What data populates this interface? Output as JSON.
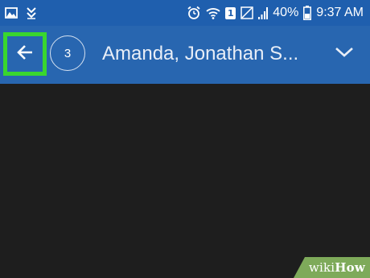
{
  "status_bar": {
    "battery_percent": "40%",
    "clock": "9:37 AM",
    "sim_label": "1",
    "icons": [
      "image-icon",
      "download-check-icon",
      "alarm-icon",
      "wifi-icon",
      "sim-icon",
      "no-signal-icon",
      "signal-icon",
      "battery-icon"
    ]
  },
  "app_bar": {
    "participant_count": "3",
    "conversation_title": "Amanda, Jonathan S...",
    "back_icon": "arrow-left-icon",
    "expand_icon": "chevron-down-icon",
    "highlight_color": "#39d62f",
    "bar_color": "#2866b0"
  },
  "watermark": {
    "wiki": "wiki",
    "how": "How"
  }
}
